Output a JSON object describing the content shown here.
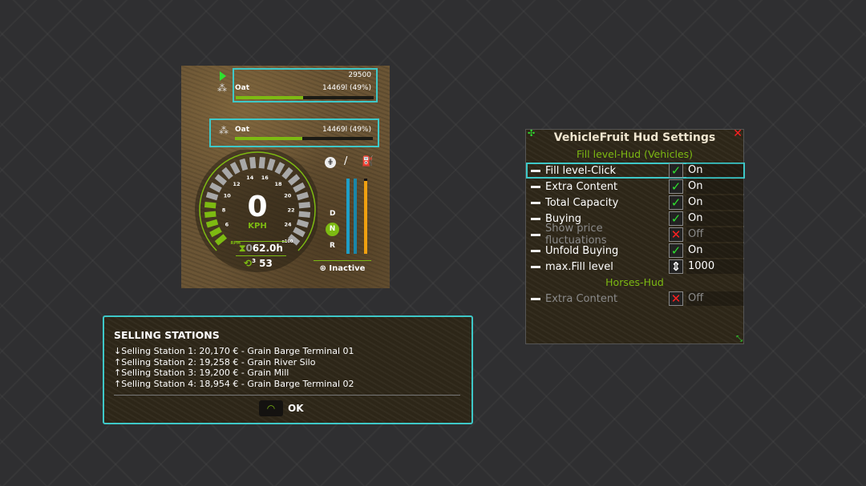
{
  "hud": {
    "fill1": {
      "total": "29500",
      "fruit": "Oat",
      "amount": "14469l (49%)",
      "percent": 49
    },
    "fill2": {
      "fruit": "Oat",
      "amount": "14469l (49%)",
      "percent": 49
    },
    "speed": "0",
    "unit": "KPH",
    "rpm_label": "RPM",
    "x100": "x100",
    "gauge_ticks": [
      "6",
      "8",
      "10",
      "12",
      "14",
      "16",
      "18",
      "20",
      "22",
      "24"
    ],
    "hours_prefix": "0",
    "hours": "62.0h",
    "cruise_level": "3",
    "cruise_speed": "53",
    "gears": [
      "D",
      "N",
      "R"
    ],
    "active_gear": "N",
    "levels": {
      "bar1": 100,
      "bar2": 100,
      "fuel": 97
    },
    "status": "Inactive",
    "colors": {
      "accent": "#7dba12",
      "blue": "#1e9fc8",
      "fuel": "#f0a010"
    }
  },
  "settings": {
    "title": "VehicleFruit Hud Settings",
    "section1": "Fill level-Hud (Vehicles)",
    "rows": [
      {
        "label": "Fill level-Click",
        "state": "check",
        "value": "On",
        "enabled": true
      },
      {
        "label": "Extra Content",
        "state": "check",
        "value": "On",
        "enabled": true
      },
      {
        "label": "Total Capacity",
        "state": "check",
        "value": "On",
        "enabled": true
      },
      {
        "label": "Buying",
        "state": "check",
        "value": "On",
        "enabled": true
      },
      {
        "label": "Show price fluctuations",
        "state": "cross",
        "value": "Off",
        "enabled": false
      },
      {
        "label": "Unfold Buying",
        "state": "check",
        "value": "On",
        "enabled": true
      },
      {
        "label": "max.Fill level",
        "state": "stepper",
        "value": "1000",
        "enabled": true
      }
    ],
    "section2": "Horses-Hud",
    "rows2": [
      {
        "label": "Extra Content",
        "state": "cross",
        "value": "Off",
        "enabled": false
      }
    ]
  },
  "selling": {
    "title": "SELLING STATIONS",
    "lines": [
      {
        "arrow": "↓",
        "text": "Selling Station 1: 20,170 € - Grain Barge Terminal 01"
      },
      {
        "arrow": "↑",
        "text": "Selling Station 2: 19,258 € - Grain River Silo"
      },
      {
        "arrow": "↑",
        "text": "Selling Station 3: 19,200 € - Grain Mill"
      },
      {
        "arrow": "↑",
        "text": "Selling Station 4: 18,954 € - Grain Barge Terminal 02"
      }
    ],
    "ok": "OK"
  }
}
